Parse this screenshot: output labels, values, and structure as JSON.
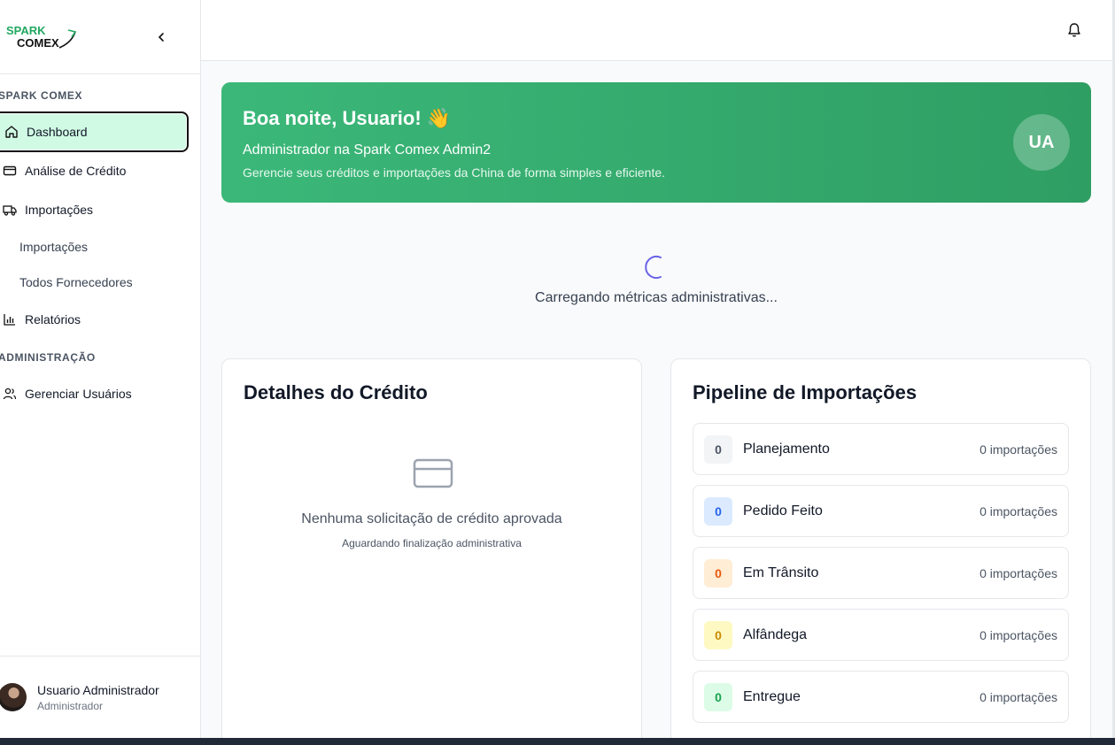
{
  "sidebar": {
    "logo_text": "SPARK COMEX",
    "section_main": "SPARK COMEX",
    "section_admin": "ADMINISTRAÇÃO",
    "items": [
      {
        "label": "Dashboard",
        "icon": "home-icon"
      },
      {
        "label": "Análise de Crédito",
        "icon": "credit-card-icon"
      },
      {
        "label": "Importações",
        "icon": "truck-icon"
      },
      {
        "label": "Importações"
      },
      {
        "label": "Todos Fornecedores"
      },
      {
        "label": "Relatórios",
        "icon": "bar-chart-icon"
      },
      {
        "label": "Gerenciar Usuários",
        "icon": "users-icon"
      }
    ],
    "profile": {
      "name": "Usuario Administrador",
      "role": "Administrador"
    }
  },
  "banner": {
    "title": "Boa noite, Usuario! 👋",
    "subtitle": "Administrador na Spark Comex Admin2",
    "description": "Gerencie seus créditos e importações da China de forma simples e eficiente.",
    "initials": "UA"
  },
  "loading": {
    "text": "Carregando métricas administrativas..."
  },
  "credit_card": {
    "title": "Detalhes do Crédito",
    "empty_title": "Nenhuma solicitação de crédito aprovada",
    "empty_subtitle": "Aguardando finalização administrativa"
  },
  "pipeline": {
    "title": "Pipeline de Importações",
    "stages": [
      {
        "count": "0",
        "name": "Planejamento",
        "label": "0 importações",
        "color": "#4b5563",
        "bg": "#f3f4f6"
      },
      {
        "count": "0",
        "name": "Pedido Feito",
        "label": "0 importações",
        "color": "#2563eb",
        "bg": "#dbeafe"
      },
      {
        "count": "0",
        "name": "Em Trânsito",
        "label": "0 importações",
        "color": "#ea580c",
        "bg": "#ffedd5"
      },
      {
        "count": "0",
        "name": "Alfândega",
        "label": "0 importações",
        "color": "#ca8a04",
        "bg": "#fef9c3"
      },
      {
        "count": "0",
        "name": "Entregue",
        "label": "0 importações",
        "color": "#16a34a",
        "bg": "#dcfce7"
      }
    ]
  },
  "colors": {
    "brand": "#2f9e63",
    "brand_dark": "#1f2937",
    "active_bg": "#d1fae5"
  }
}
